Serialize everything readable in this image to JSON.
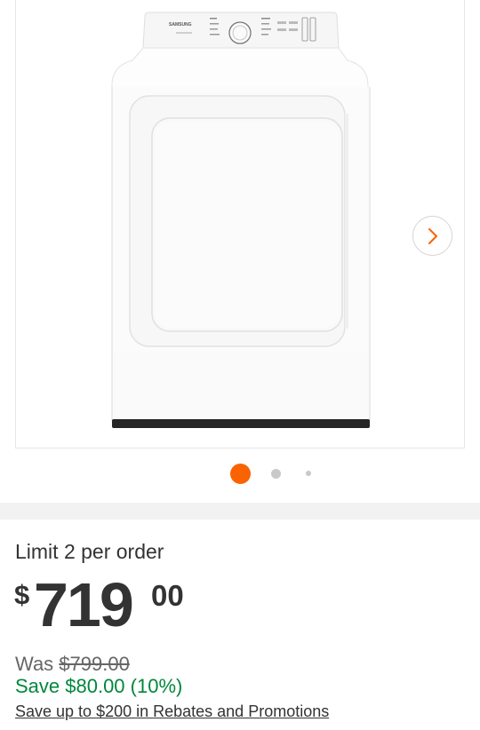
{
  "gallery": {
    "image_alt": "Samsung white electric dryer",
    "brand_text": "SAMSUNG",
    "next_icon": "chevron-right-icon",
    "accent_color": "#f96302",
    "total_dots": 3,
    "active_dot": 1
  },
  "product": {
    "limit_text": "Limit 2 per order",
    "price_symbol": "$",
    "price_dollars": "719",
    "price_cents": "00",
    "was_label": "Was",
    "was_price": "$799.00",
    "save_text": "Save $80.00 (10%)",
    "rebates_link": "Save up to $200 in Rebates and Promotions"
  },
  "colors": {
    "save_green": "#00873c",
    "accent_orange": "#f96302"
  }
}
